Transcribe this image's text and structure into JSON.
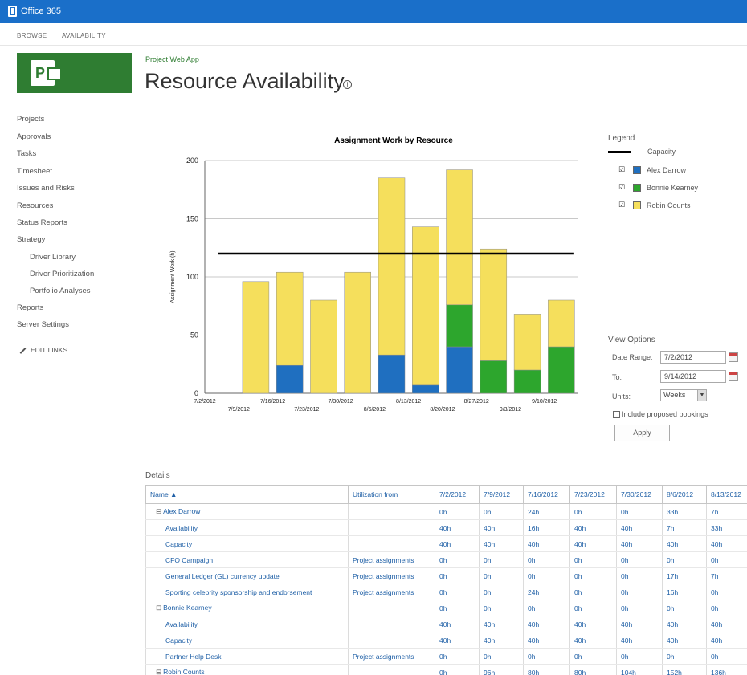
{
  "app": {
    "suite_name": "Office 365"
  },
  "ribbon": {
    "tabs": [
      "BROWSE",
      "AVAILABILITY"
    ]
  },
  "header": {
    "breadcrumb": "Project Web App",
    "title": "Resource Availability",
    "info_glyph": "i"
  },
  "logo": {
    "letter": "P"
  },
  "nav": {
    "items": [
      {
        "label": "Projects",
        "sub": false
      },
      {
        "label": "Approvals",
        "sub": false
      },
      {
        "label": "Tasks",
        "sub": false
      },
      {
        "label": "Timesheet",
        "sub": false
      },
      {
        "label": "Issues and Risks",
        "sub": false
      },
      {
        "label": "Resources",
        "sub": false
      },
      {
        "label": "Status Reports",
        "sub": false
      },
      {
        "label": "Strategy",
        "sub": false
      },
      {
        "label": "Driver Library",
        "sub": true
      },
      {
        "label": "Driver Prioritization",
        "sub": true
      },
      {
        "label": "Portfolio Analyses",
        "sub": true
      },
      {
        "label": "Reports",
        "sub": false
      },
      {
        "label": "Server Settings",
        "sub": false
      }
    ],
    "edit_links": "EDIT LINKS"
  },
  "legend": {
    "title": "Legend",
    "capacity_label": "Capacity",
    "check_glyph": "☑",
    "entries": [
      {
        "label": "Alex Darrow",
        "color": "#1f6fc0"
      },
      {
        "label": "Bonnie Kearney",
        "color": "#2da62d"
      },
      {
        "label": "Robin Counts",
        "color": "#f5df5c"
      }
    ]
  },
  "view_options": {
    "title": "View Options",
    "date_range_label": "Date Range:",
    "date_range_value": "7/2/2012",
    "to_label": "To:",
    "to_value": "9/14/2012",
    "units_label": "Units:",
    "units_value": "Weeks",
    "units_arrow": "▼",
    "proposed_label": "Include proposed bookings",
    "apply_label": "Apply"
  },
  "chart_data": {
    "type": "bar",
    "stacked": true,
    "title": "Assignment Work by Resource",
    "xlabel": "",
    "ylabel": "Assignment Work (h)",
    "ylim": [
      0,
      200
    ],
    "yticks": [
      0,
      50,
      100,
      150,
      200
    ],
    "grid": true,
    "categories": [
      "7/2/2012",
      "7/9/2012",
      "7/16/2012",
      "7/23/2012",
      "7/30/2012",
      "8/6/2012",
      "8/13/2012",
      "8/20/2012",
      "8/27/2012",
      "9/3/2012",
      "9/10/2012"
    ],
    "series": [
      {
        "name": "Alex Darrow",
        "color": "#1f6fc0",
        "values": [
          0,
          0,
          24,
          0,
          0,
          33,
          7,
          40,
          0,
          0,
          0
        ]
      },
      {
        "name": "Bonnie Kearney",
        "color": "#2da62d",
        "values": [
          0,
          0,
          0,
          0,
          0,
          0,
          0,
          36,
          28,
          20,
          40
        ]
      },
      {
        "name": "Robin Counts",
        "color": "#f5df5c",
        "values": [
          0,
          96,
          80,
          80,
          104,
          152,
          136,
          116,
          96,
          48,
          40
        ]
      }
    ],
    "capacity": {
      "name": "Capacity",
      "value": 120,
      "color": "#000000"
    }
  },
  "details": {
    "title": "Details",
    "columns": [
      "Name ▲",
      "Utilization from",
      "7/2/2012",
      "7/9/2012",
      "7/16/2012",
      "7/23/2012",
      "7/30/2012",
      "8/6/2012",
      "8/13/2012"
    ],
    "rows": [
      {
        "kind": "group",
        "name": "Alex Darrow",
        "util": "",
        "values": [
          "0h",
          "0h",
          "24h",
          "0h",
          "0h",
          "33h",
          "7h"
        ]
      },
      {
        "kind": "child",
        "name": "Availability",
        "util": "",
        "values": [
          "40h",
          "40h",
          "16h",
          "40h",
          "40h",
          "7h",
          "33h"
        ]
      },
      {
        "kind": "child",
        "name": "Capacity",
        "util": "",
        "values": [
          "40h",
          "40h",
          "40h",
          "40h",
          "40h",
          "40h",
          "40h"
        ]
      },
      {
        "kind": "child",
        "name": "CFO Campaign",
        "util": "Project assignments",
        "values": [
          "0h",
          "0h",
          "0h",
          "0h",
          "0h",
          "0h",
          "0h"
        ]
      },
      {
        "kind": "child",
        "name": "General Ledger (GL) currency update",
        "util": "Project assignments",
        "values": [
          "0h",
          "0h",
          "0h",
          "0h",
          "0h",
          "17h",
          "7h"
        ]
      },
      {
        "kind": "child",
        "name": "Sporting celebrity sponsorship and endorsement",
        "util": "Project assignments",
        "values": [
          "0h",
          "0h",
          "24h",
          "0h",
          "0h",
          "16h",
          "0h"
        ]
      },
      {
        "kind": "group",
        "name": "Bonnie Kearney",
        "util": "",
        "values": [
          "0h",
          "0h",
          "0h",
          "0h",
          "0h",
          "0h",
          "0h"
        ]
      },
      {
        "kind": "child",
        "name": "Availability",
        "util": "",
        "values": [
          "40h",
          "40h",
          "40h",
          "40h",
          "40h",
          "40h",
          "40h"
        ]
      },
      {
        "kind": "child",
        "name": "Capacity",
        "util": "",
        "values": [
          "40h",
          "40h",
          "40h",
          "40h",
          "40h",
          "40h",
          "40h"
        ]
      },
      {
        "kind": "child",
        "name": "Partner Help Desk",
        "util": "Project assignments",
        "values": [
          "0h",
          "0h",
          "0h",
          "0h",
          "0h",
          "0h",
          "0h"
        ]
      },
      {
        "kind": "group",
        "name": "Robin Counts",
        "util": "",
        "values": [
          "0h",
          "96h",
          "80h",
          "80h",
          "104h",
          "152h",
          "136h"
        ]
      }
    ]
  }
}
